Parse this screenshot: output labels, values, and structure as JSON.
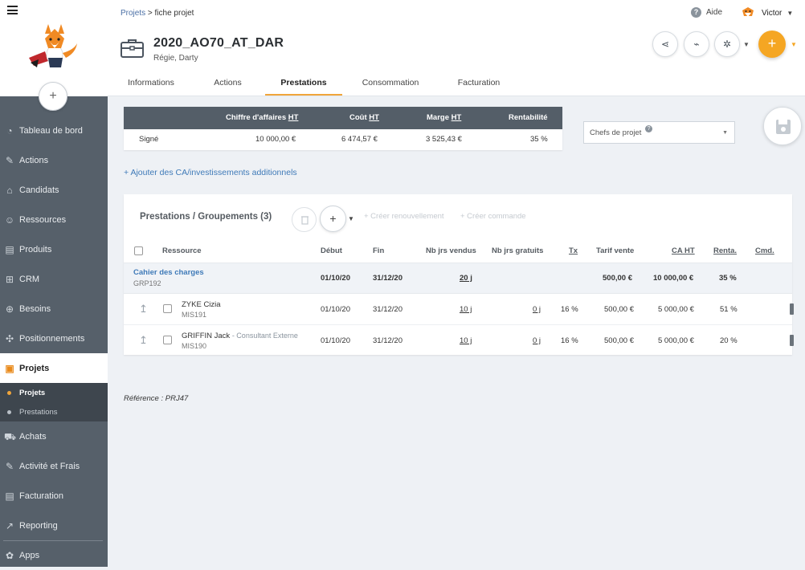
{
  "sidebar": {
    "items": [
      {
        "label": "Tableau de bord",
        "icon": "speedometer-icon"
      },
      {
        "label": "Actions",
        "icon": "edit-icon"
      },
      {
        "label": "Candidats",
        "icon": "graduation-cap-icon"
      },
      {
        "label": "Ressources",
        "icon": "people-icon"
      },
      {
        "label": "Produits",
        "icon": "document-icon"
      },
      {
        "label": "CRM",
        "icon": "sitemap-icon"
      },
      {
        "label": "Besoins",
        "icon": "crosshair-icon"
      },
      {
        "label": "Positionnements",
        "icon": "puzzle-icon"
      },
      {
        "label": "Projets",
        "icon": "briefcase-icon",
        "active": true
      },
      {
        "label": "Achats",
        "icon": "cart-icon"
      },
      {
        "label": "Activité et Frais",
        "icon": "edit-icon"
      },
      {
        "label": "Facturation",
        "icon": "invoice-icon"
      },
      {
        "label": "Reporting",
        "icon": "line-chart-icon"
      },
      {
        "label": "Apps",
        "icon": "apps-icon"
      }
    ],
    "subitems": [
      {
        "label": "Projets",
        "color": "#f0a53a",
        "selected": true
      },
      {
        "label": "Prestations",
        "color": "#b9c0c7",
        "selected": false
      }
    ]
  },
  "header": {
    "breadcrumb_link": "Projets",
    "breadcrumb_sep": ">",
    "breadcrumb_current": "fiche projet",
    "help_label": "Aide",
    "user_name": "Victor",
    "project_title": "2020_AO70_AT_DAR",
    "project_subtitle": "Régie, Darty",
    "tabs": [
      "Informations",
      "Actions",
      "Prestations",
      "Consommation",
      "Facturation"
    ],
    "active_tab": "Prestations",
    "accent": "#f5a623"
  },
  "kpi": {
    "headers": [
      "Chiffre d'affaires",
      "HT",
      "Coût",
      "HT",
      "Marge",
      "HT",
      "Rentabilité"
    ],
    "row": {
      "label": "Signé",
      "ca": "10 000,00 €",
      "cout": "6 474,57 €",
      "marge": "3 525,43 €",
      "renta": "35 %"
    }
  },
  "chefs_select": {
    "placeholder": "Chefs de projet",
    "help": "?"
  },
  "add_link": "+ Ajouter des CA/investissements additionnels",
  "panel": {
    "title": "Prestations / Groupements (3)",
    "renew_label": "+ Créer renouvellement",
    "order_label": "+ Créer commande",
    "columns": [
      "Ressource",
      "Début",
      "Fin",
      "Nb jrs vendus",
      "Nb jrs gratuits",
      "Tx",
      "Tarif vente",
      "CA HT",
      "Renta.",
      "Cmd."
    ],
    "group": {
      "name": "Cahier des charges",
      "ref": "GRP192",
      "debut": "01/10/20",
      "fin": "31/12/20",
      "jrs": "20 j",
      "tarif": "500,00 €",
      "ca": "10 000,00 €",
      "renta": "35 %"
    },
    "rows": [
      {
        "name": "ZYKE Cizia",
        "tag": "",
        "ref": "MIS191",
        "debut": "01/10/20",
        "fin": "31/12/20",
        "jrs": "10 j",
        "gratuits": "0 j",
        "tx": "16 %",
        "tarif": "500,00 €",
        "ca": "5 000,00 €",
        "renta": "51 %"
      },
      {
        "name": "GRIFFIN Jack",
        "tag": "- Consultant Externe",
        "ref": "MIS190",
        "debut": "01/10/20",
        "fin": "31/12/20",
        "jrs": "10 j",
        "gratuits": "0 j",
        "tx": "16 %",
        "tarif": "500,00 €",
        "ca": "5 000,00 €",
        "renta": "20 %"
      }
    ]
  },
  "reference": {
    "label": "Référence :",
    "value": "PRJ47"
  }
}
